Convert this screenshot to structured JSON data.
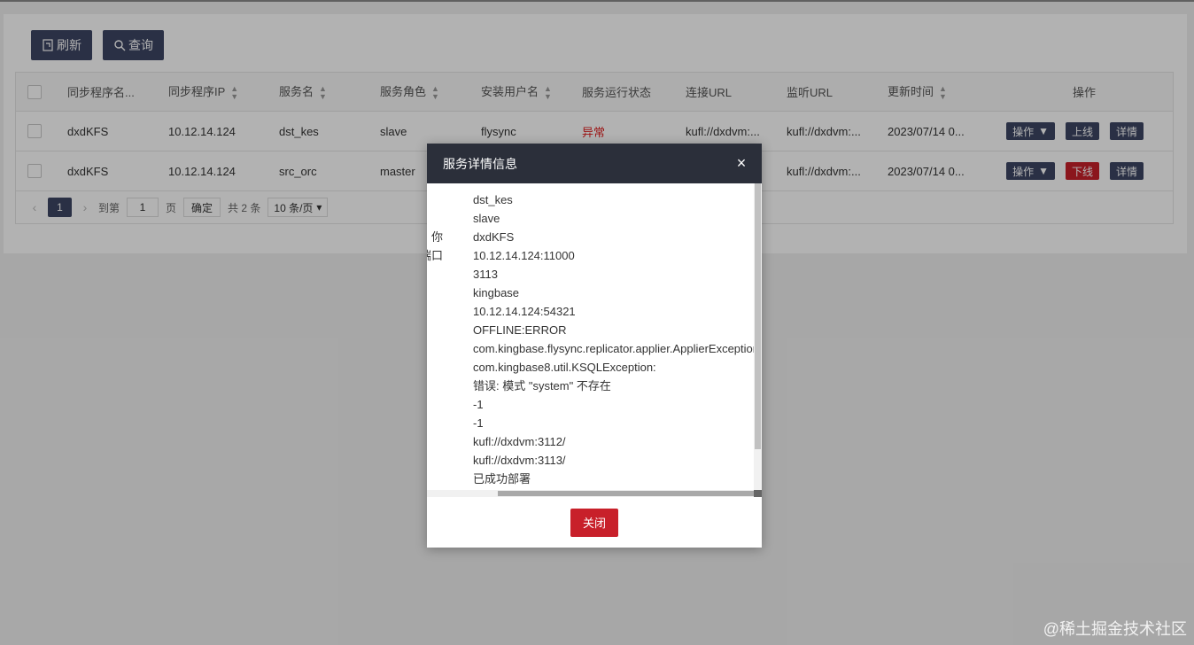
{
  "toolbar": {
    "refresh_label": "刷新",
    "query_label": "查询"
  },
  "table": {
    "headers": [
      "同步程序名...",
      "同步程序IP",
      "服务名",
      "服务角色",
      "安装用户名",
      "服务运行状态",
      "连接URL",
      "监听URL",
      "更新时间",
      "操作"
    ],
    "rows": [
      {
        "name": "dxdKFS",
        "ip": "10.12.14.124",
        "service": "dst_kes",
        "role": "slave",
        "user": "flysync",
        "status": "异常",
        "conn_url": "kufl://dxdvm:...",
        "listen_url": "kufl://dxdvm:...",
        "updated": "2023/07/14 0...",
        "op_label": "操作",
        "toggle_label": "上线",
        "detail_label": "详情"
      },
      {
        "name": "dxdKFS",
        "ip": "10.12.14.124",
        "service": "src_orc",
        "role": "master",
        "user": "",
        "status": "",
        "conn_url": "",
        "listen_url": "kufl://dxdvm:...",
        "updated": "2023/07/14 0...",
        "op_label": "操作",
        "toggle_label": "下线",
        "detail_label": "详情"
      }
    ]
  },
  "pager": {
    "current": "1",
    "goto_label": "到第",
    "goto_value": "1",
    "page_unit": "页",
    "confirm": "确定",
    "total": "共 2 条",
    "page_size": "10 条/页"
  },
  "dialog": {
    "title": "服务详情信息",
    "close_label": "关闭",
    "fields": [
      {
        "key": "",
        "value": "dst_kes"
      },
      {
        "key": "",
        "value": "slave"
      },
      {
        "key": "你",
        "value": "dxdKFS"
      },
      {
        "key": "端口",
        "value": "10.12.14.124:11000"
      },
      {
        "key": "",
        "value": "3113"
      },
      {
        "key": "",
        "value": "kingbase"
      },
      {
        "key": "",
        "value": "10.12.14.124:54321"
      },
      {
        "key": "",
        "value": "OFFLINE:ERROR"
      },
      {
        "key": "",
        "value": "com.kingbase.flysync.replicator.applier.ApplierException:"
      },
      {
        "key": "",
        "value": "com.kingbase8.util.KSQLException:"
      },
      {
        "key": "",
        "value": "错误: 模式 \"system\" 不存在"
      },
      {
        "key": "",
        "value": "-1"
      },
      {
        "key": "",
        "value": "-1"
      },
      {
        "key": "",
        "value": "kufl://dxdvm:3112/"
      },
      {
        "key": "",
        "value": "kufl://dxdvm:3113/"
      },
      {
        "key": "",
        "value": "已成功部署"
      }
    ]
  },
  "watermark": "@稀土掘金技术社区",
  "colors": {
    "primary": "#3d4663",
    "danger": "#c8202a",
    "dialog_header": "#2b2f3a"
  }
}
